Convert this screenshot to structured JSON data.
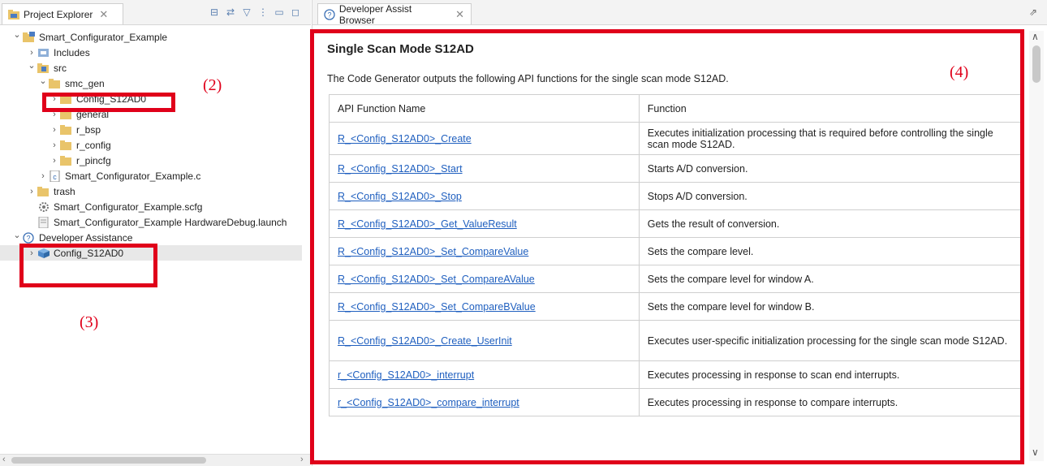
{
  "project_explorer": {
    "tab_title": "Project Explorer",
    "tree": [
      {
        "label": "Smart_Configurator_Example",
        "arrow": "v",
        "icon": "project-icon"
      },
      {
        "label": "Includes",
        "arrow": ">",
        "icon": "includes-icon"
      },
      {
        "label": "src",
        "arrow": "v",
        "icon": "source-folder-icon"
      },
      {
        "label": "smc_gen",
        "arrow": "v",
        "icon": "folder-icon"
      },
      {
        "label": "Config_S12AD0",
        "arrow": ">",
        "icon": "folder-icon"
      },
      {
        "label": "general",
        "arrow": ">",
        "icon": "folder-icon"
      },
      {
        "label": "r_bsp",
        "arrow": ">",
        "icon": "folder-icon"
      },
      {
        "label": "r_config",
        "arrow": ">",
        "icon": "folder-icon"
      },
      {
        "label": "r_pincfg",
        "arrow": ">",
        "icon": "folder-icon"
      },
      {
        "label": "Smart_Configurator_Example.c",
        "arrow": ">",
        "icon": "c-file-icon"
      },
      {
        "label": "trash",
        "arrow": ">",
        "icon": "folder-icon"
      },
      {
        "label": "Smart_Configurator_Example.scfg",
        "arrow": "",
        "icon": "config-file-icon"
      },
      {
        "label": "Smart_Configurator_Example HardwareDebug.launch",
        "arrow": "",
        "icon": "launch-file-icon"
      },
      {
        "label": "Developer Assistance",
        "arrow": "v",
        "icon": "help-icon"
      },
      {
        "label": "Config_S12AD0",
        "arrow": ">",
        "icon": "component-icon"
      }
    ]
  },
  "annotations": {
    "a2": "(2)",
    "a3": "(3)",
    "a4": "(4)"
  },
  "browser": {
    "tab_title": "Developer Assist Browser",
    "heading": "Single Scan Mode S12AD",
    "description": "The Code Generator outputs the following API functions for the single scan mode S12AD.",
    "columns": [
      "API Function Name",
      "Function"
    ],
    "rows": [
      {
        "name": "R_<Config_S12AD0>_Create",
        "desc": "Executes initialization processing that is required before controlling the single scan mode S12AD."
      },
      {
        "name": "R_<Config_S12AD0>_Start",
        "desc": "Starts A/D conversion."
      },
      {
        "name": "R_<Config_S12AD0>_Stop",
        "desc": "Stops A/D conversion."
      },
      {
        "name": "R_<Config_S12AD0>_Get_ValueResult",
        "desc": "Gets the result of conversion."
      },
      {
        "name": "R_<Config_S12AD0>_Set_CompareValue",
        "desc": "Sets the compare level."
      },
      {
        "name": "R_<Config_S12AD0>_Set_CompareAValue",
        "desc": "Sets the compare level for window A."
      },
      {
        "name": "R_<Config_S12AD0>_Set_CompareBValue",
        "desc": "Sets the compare level for window B."
      },
      {
        "name": "R_<Config_S12AD0>_Create_UserInit",
        "desc": "Executes user-specific initialization processing for the single scan mode S12AD."
      },
      {
        "name": "r_<Config_S12AD0>_interrupt",
        "desc": "Executes processing in response to scan end interrupts."
      },
      {
        "name": "r_<Config_S12AD0>_compare_interrupt",
        "desc": "Executes processing in response to compare interrupts."
      }
    ]
  },
  "colors": {
    "annotation_red": "#e0001a",
    "link_blue": "#1f5fbf",
    "folder_yellow": "#e9c46a"
  }
}
